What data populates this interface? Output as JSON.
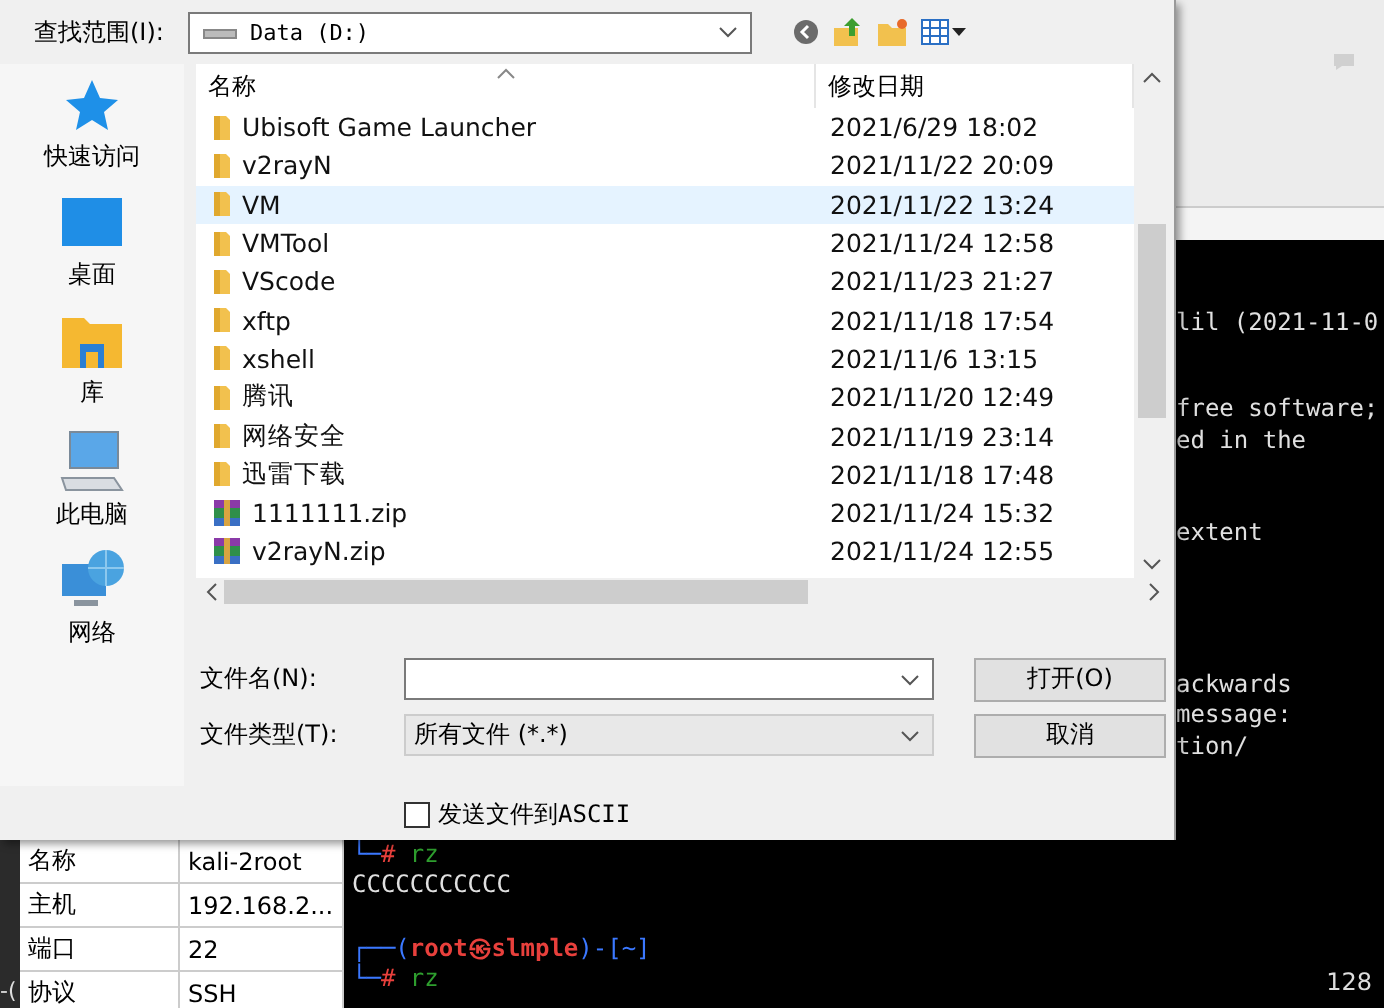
{
  "dialog": {
    "look_in": {
      "label": "查找范围(I):",
      "value": "Data (D:)"
    },
    "places": [
      {
        "label": "快速访问",
        "kind": "star"
      },
      {
        "label": "桌面",
        "kind": "desktop"
      },
      {
        "label": "库",
        "kind": "library"
      },
      {
        "label": "此电脑",
        "kind": "computer"
      },
      {
        "label": "网络",
        "kind": "network"
      }
    ],
    "file_list": {
      "columns": [
        "名称",
        "修改日期"
      ],
      "rows": [
        {
          "name": "Ubisoft Game Launcher",
          "date": "2021/6/29 18:02",
          "kind": "folder",
          "selected": false
        },
        {
          "name": "v2rayN",
          "date": "2021/11/22 20:09",
          "kind": "folder",
          "selected": false
        },
        {
          "name": "VM",
          "date": "2021/11/22 13:24",
          "kind": "folder",
          "selected": true
        },
        {
          "name": "VMTool",
          "date": "2021/11/24 12:58",
          "kind": "folder",
          "selected": false
        },
        {
          "name": "VScode",
          "date": "2021/11/23 21:27",
          "kind": "folder",
          "selected": false
        },
        {
          "name": "xftp",
          "date": "2021/11/18 17:54",
          "kind": "folder",
          "selected": false
        },
        {
          "name": "xshell",
          "date": "2021/11/6 13:15",
          "kind": "folder",
          "selected": false
        },
        {
          "name": "腾讯",
          "date": "2021/11/20 12:49",
          "kind": "folder",
          "selected": false
        },
        {
          "name": "网络安全",
          "date": "2021/11/19 23:14",
          "kind": "folder",
          "selected": false
        },
        {
          "name": "迅雷下载",
          "date": "2021/11/18 17:48",
          "kind": "folder",
          "selected": false
        },
        {
          "name": "1111111.zip",
          "date": "2021/11/24 15:32",
          "kind": "zip",
          "selected": false
        },
        {
          "name": "v2rayN.zip",
          "date": "2021/11/24 12:55",
          "kind": "zip",
          "selected": false
        }
      ]
    },
    "file_name": {
      "label": "文件名(N):"
    },
    "file_type": {
      "label": "文件类型(T):",
      "value": "所有文件 (*.*)"
    },
    "buttons": [
      "打开(O)",
      "取消"
    ],
    "ascii_checkbox": {
      "label": "发送文件到ASCII",
      "checked": false
    }
  },
  "session_properties": [
    {
      "key": "名称",
      "value": "kali-2root"
    },
    {
      "key": "主机",
      "value": "192.168.2..."
    },
    {
      "key": "端口",
      "value": "22"
    },
    {
      "key": "协议",
      "value": "SSH"
    }
  ],
  "side_fragment": "-(",
  "terminal_right": [
    [
      "lil (2021-11-0"
    ],
    [
      "free software;",
      "ed in the"
    ],
    [
      "extent"
    ],
    [
      "ackwards",
      "message:",
      "tion/"
    ]
  ],
  "terminal_bottom": [
    [
      [
        {
          "kind": "frame",
          "text": "└─"
        },
        {
          "kind": "hash",
          "text": "#"
        },
        {
          "kind": "command",
          "text": " rz"
        }
      ],
      [
        {
          "kind": "plain",
          "text": "CCCCCCCCCCC"
        }
      ]
    ],
    [
      [
        {
          "kind": "frame",
          "text": "┌──("
        },
        {
          "kind": "user",
          "text": "root㉿slmple"
        },
        {
          "kind": "frame",
          "text": ")-[~]"
        }
      ],
      [
        {
          "kind": "frame",
          "text": "└─"
        },
        {
          "kind": "hash",
          "text": "#"
        },
        {
          "kind": "command",
          "text": " rz"
        }
      ]
    ]
  ],
  "terminal_counter": "128"
}
